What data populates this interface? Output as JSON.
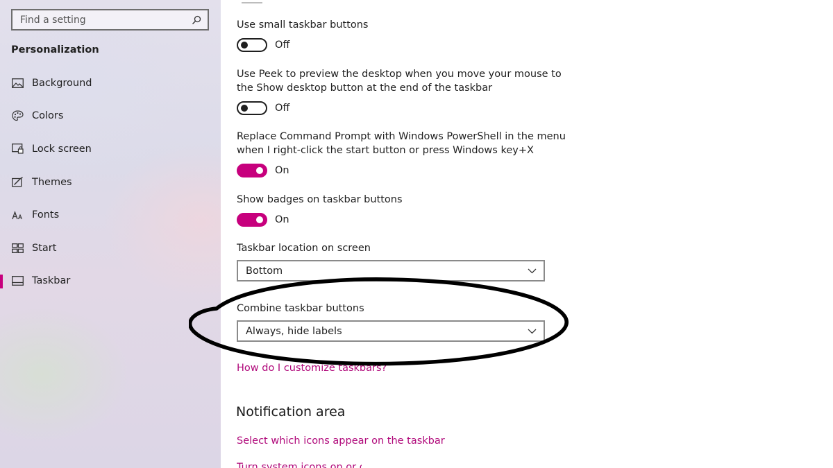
{
  "sidebar": {
    "search_placeholder": "Find a setting",
    "section_title": "Personalization",
    "items": [
      {
        "label": "Background",
        "icon": "image-icon"
      },
      {
        "label": "Colors",
        "icon": "palette-icon"
      },
      {
        "label": "Lock screen",
        "icon": "lock-screen-icon"
      },
      {
        "label": "Themes",
        "icon": "themes-icon"
      },
      {
        "label": "Fonts",
        "icon": "fonts-icon"
      },
      {
        "label": "Start",
        "icon": "start-icon"
      },
      {
        "label": "Taskbar",
        "icon": "taskbar-icon",
        "active": true
      }
    ]
  },
  "main": {
    "settings": [
      {
        "label": "Use small taskbar buttons",
        "state": "Off"
      },
      {
        "label_line1": "Use Peek to preview the desktop when you move your mouse to",
        "label_line2": "the Show desktop button at the end of the taskbar",
        "state": "Off"
      },
      {
        "label_line1": "Replace Command Prompt with Windows PowerShell in the menu",
        "label_line2": "when I right-click the start button or press Windows key+X",
        "state": "On"
      },
      {
        "label": "Show badges on taskbar buttons",
        "state": "On"
      }
    ],
    "location": {
      "label": "Taskbar location on screen",
      "value": "Bottom"
    },
    "combine": {
      "label": "Combine taskbar buttons",
      "value": "Always, hide labels"
    },
    "help_link": "How do I customize taskbars?",
    "notification_heading": "Notification area",
    "notification_link1": "Select which icons appear on the taskbar",
    "notification_link2": "Turn system icons on or off"
  },
  "colors": {
    "accent": "#c7007d",
    "link": "#b0087a",
    "annotation": "#000000"
  }
}
